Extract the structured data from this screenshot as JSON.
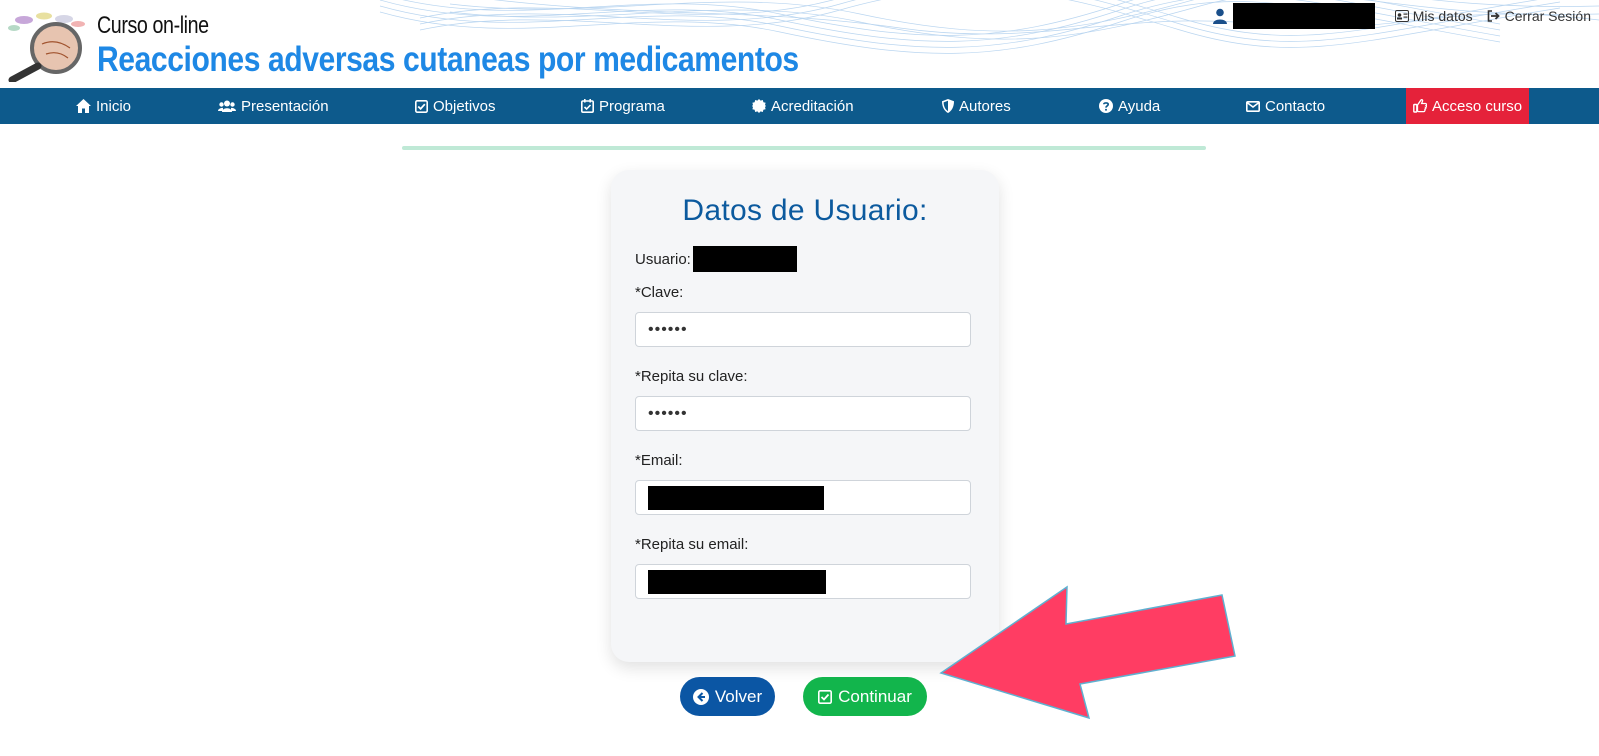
{
  "header": {
    "brand_small": "Curso on-line",
    "brand_title": "Reacciones adversas cutaneas por medicamentos",
    "user_links": [
      {
        "label": "Mis datos",
        "icon": "id-card-icon"
      },
      {
        "label": "Cerrar Sesión",
        "icon": "sign-out-icon"
      }
    ]
  },
  "nav": {
    "items": [
      {
        "label": "Inicio",
        "icon": "home-icon"
      },
      {
        "label": "Presentación",
        "icon": "users-icon"
      },
      {
        "label": "Objetivos",
        "icon": "check-square-icon"
      },
      {
        "label": "Programa",
        "icon": "calendar-check-icon"
      },
      {
        "label": "Acreditación",
        "icon": "certificate-icon"
      },
      {
        "label": "Autores",
        "icon": "shield-icon"
      },
      {
        "label": "Ayuda",
        "icon": "question-circle-icon"
      },
      {
        "label": "Contacto",
        "icon": "envelope-icon"
      },
      {
        "label": "Acceso curso",
        "icon": "hand-pointer-icon",
        "active": true
      }
    ]
  },
  "form": {
    "title": "Datos de Usuario:",
    "user_label": "Usuario:",
    "password_label": "*Clave:",
    "password_value": "••••••",
    "password_repeat_label": "*Repita su clave:",
    "password_repeat_value": "••••••",
    "email_label": "*Email:",
    "email_repeat_label": "*Repita su email:"
  },
  "buttons": {
    "back_label": "Volver",
    "continue_label": "Continuar"
  },
  "colors": {
    "nav_bg": "#0d5a8c",
    "nav_active": "#e5223a",
    "title_blue": "#0c5a9e",
    "btn_back": "#0b56a4",
    "btn_continue": "#12b54c",
    "arrow": "#ff3d63"
  }
}
